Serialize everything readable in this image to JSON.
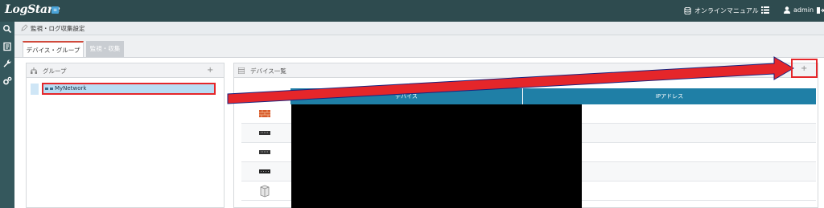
{
  "app": {
    "logo": "LogStare",
    "logo_badge": "≡",
    "manual_link": "オンラインマニュアル",
    "user": "admin"
  },
  "breadcrumb": {
    "text": "監視・ログ収集設定"
  },
  "tabs": [
    {
      "label": "デバイス・グループ",
      "active": true
    },
    {
      "label": "監視・収集",
      "active": false
    }
  ],
  "group_panel": {
    "title": "グループ",
    "add_label": "+",
    "tree": [
      {
        "label": "MyNetwork",
        "selected": true
      }
    ]
  },
  "device_panel": {
    "title": "デバイス一覧",
    "add_label": "+",
    "columns": [
      "デバイス",
      "IPアドレス"
    ],
    "rows": [
      {
        "icon": "firewall-icon"
      },
      {
        "icon": "switch-icon"
      },
      {
        "icon": "switch-icon"
      },
      {
        "icon": "router-icon"
      },
      {
        "icon": "server-icon"
      }
    ]
  },
  "colors": {
    "topbar": "#2e4b4f",
    "table_header": "#1f7fa6",
    "highlight": "#e5262a",
    "selected_row": "#b9dcf3"
  }
}
